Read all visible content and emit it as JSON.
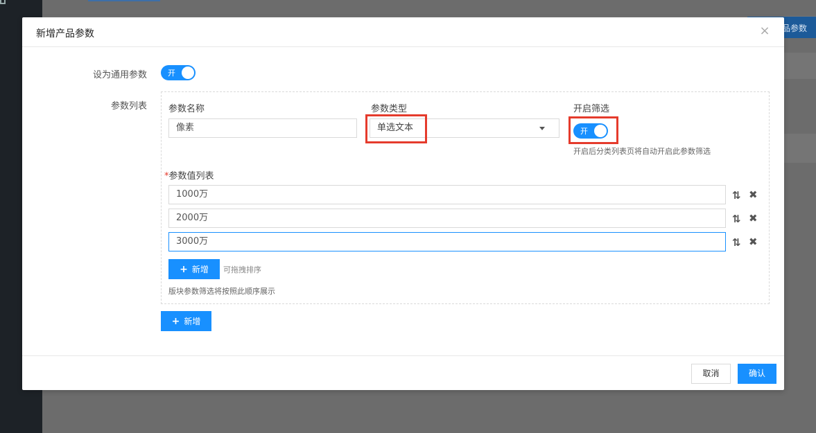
{
  "background": {
    "right_button_label": "品参数"
  },
  "modal": {
    "title": "新增产品参数",
    "close_icon": "close-icon",
    "general_param": {
      "label": "设为通用参数",
      "toggle_label": "开",
      "on": true
    },
    "param_list": {
      "label": "参数列表",
      "name_col_title": "参数名称",
      "name_value": "像素",
      "type_col_title": "参数类型",
      "type_value": "单选文本",
      "filter_col_title": "开启筛选",
      "filter_toggle_label": "开",
      "filter_on": true,
      "filter_hint": "开启后分类列表页将自动开启此参数筛选",
      "values_title": "参数值列表",
      "required_mark": "*",
      "values": [
        {
          "value": "1000万"
        },
        {
          "value": "2000万"
        },
        {
          "value": "3000万"
        }
      ],
      "add_value_label": "新增",
      "drag_hint": "可拖拽排序",
      "order_hint": "版块参数筛选将按照此顺序展示"
    },
    "add_param_label": "新增",
    "footer": {
      "cancel_label": "取消",
      "confirm_label": "确认"
    }
  },
  "colors": {
    "primary": "#1890ff",
    "highlight": "#e53b2c"
  }
}
